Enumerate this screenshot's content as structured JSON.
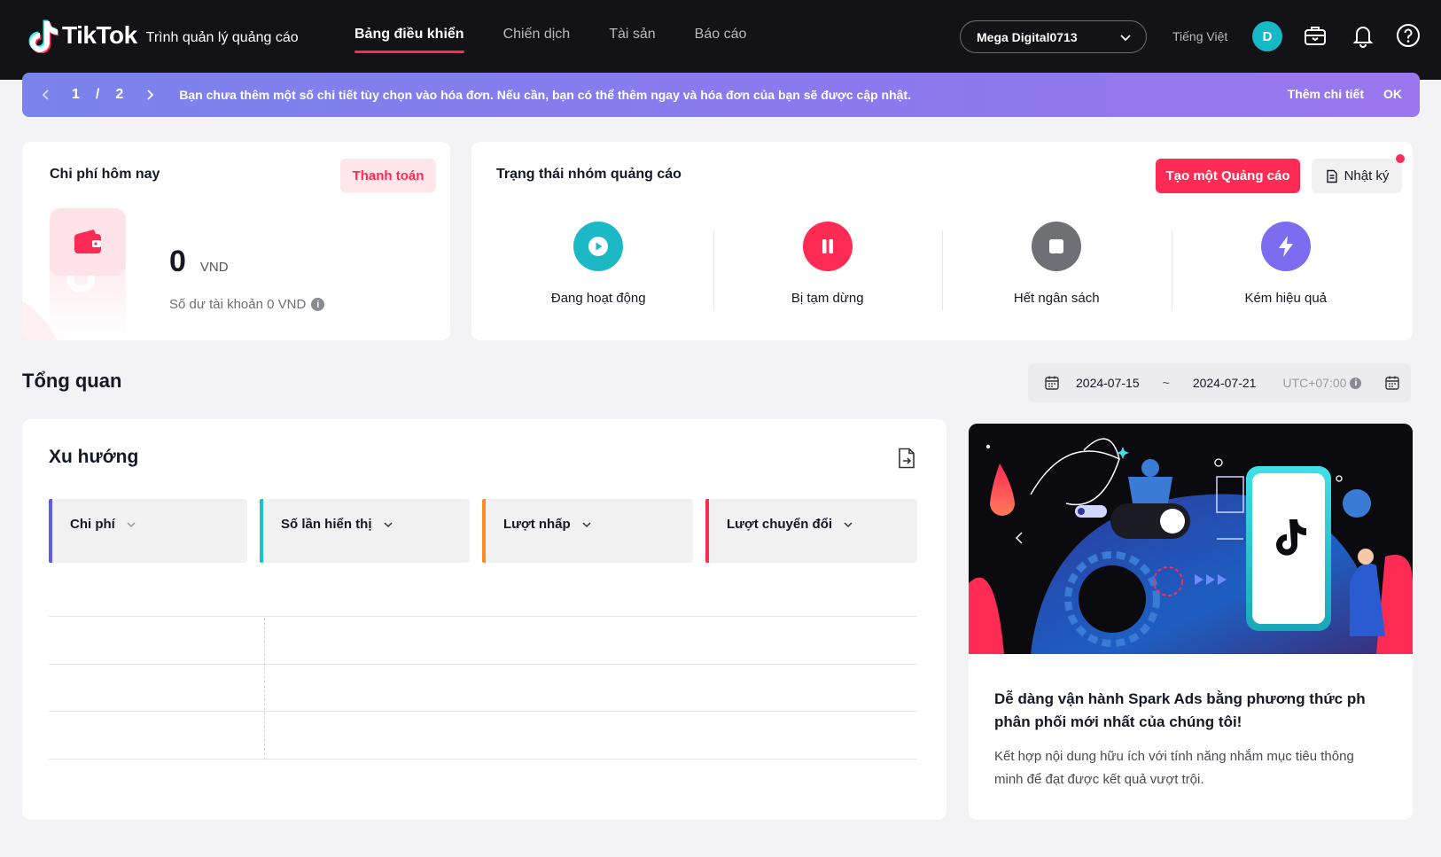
{
  "header": {
    "brand": "TikTok",
    "subtitle": "Trình quản lý quảng cáo",
    "nav": [
      {
        "label": "Bảng điều khiển",
        "active": true
      },
      {
        "label": "Chiến dịch",
        "active": false
      },
      {
        "label": "Tài sản",
        "active": false
      },
      {
        "label": "Báo cáo",
        "active": false
      }
    ],
    "account": "Mega Digital0713",
    "language": "Tiếng Việt",
    "avatar_initial": "D"
  },
  "banner": {
    "page_current": "1",
    "page_sep": "/",
    "page_total": "2",
    "message": "Bạn chưa thêm một số chi tiết tùy chọn vào hóa đơn. Nếu cần, bạn có thể thêm ngay và hóa đơn của bạn sẽ được cập nhật.",
    "action_add": "Thêm chi tiết",
    "action_ok": "OK"
  },
  "cost_card": {
    "title": "Chi phí hôm nay",
    "pay_button": "Thanh toán",
    "amount": "0",
    "currency": "VND",
    "balance": "Số dư tài khoản 0 VND"
  },
  "status_card": {
    "title": "Trạng thái nhóm quảng cáo",
    "create_button": "Tạo một Quảng cáo",
    "log_button": "Nhật ký",
    "items": [
      {
        "label": "Đang hoạt động",
        "color": "#1cb8c5",
        "icon": "play-icon"
      },
      {
        "label": "Bị tạm dừng",
        "color": "#fe2c55",
        "icon": "pause-icon"
      },
      {
        "label": "Hết ngân sách",
        "color": "#6f6f76",
        "icon": "stop-icon"
      },
      {
        "label": "Kém hiệu quả",
        "color": "#7b6cf0",
        "icon": "lightning-icon"
      }
    ]
  },
  "overview": {
    "title": "Tổng quan",
    "date_start": "2024-07-15",
    "date_sep": "~",
    "date_end": "2024-07-21",
    "timezone": "UTC+07:00"
  },
  "trend": {
    "title": "Xu hướng",
    "metrics": [
      {
        "label": "Chi phí",
        "color": "#5b5ee6"
      },
      {
        "label": "Số lần hiển thị",
        "color": "#19c3c9"
      },
      {
        "label": "Lượt nhấp",
        "color": "#ff8a1f"
      },
      {
        "label": "Lượt chuyển đổi",
        "color": "#fe2c55"
      }
    ]
  },
  "promo": {
    "heading": "Dễ dàng vận hành Spark Ads bằng phương thức ph phân phối mới nhất của chúng tôi!",
    "body": "Kết hợp nội dung hữu ích với tính năng nhắm mục tiêu thông minh để đạt được kết quả vượt trội."
  }
}
